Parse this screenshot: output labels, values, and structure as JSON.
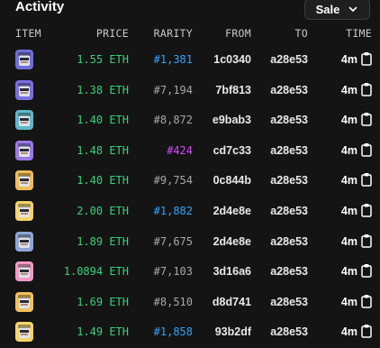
{
  "header": {
    "title": "Activity",
    "filter": "Sale"
  },
  "columns": {
    "item": "ITEM",
    "price": "PRICE",
    "rarity": "RARITY",
    "from": "FROM",
    "to": "TO",
    "time": "TIME"
  },
  "colors": {
    "price": "#34d47a",
    "rarity_blue": "#2fa4ff",
    "rarity_gray": "#a8a8a8",
    "rarity_purple": "#d24bff",
    "background": "#141414"
  },
  "rows": [
    {
      "avatar": "#6f6fd8",
      "price": "1.55 ETH",
      "rarity": "#1,381",
      "rarity_tone": "blue",
      "from": "1c0340",
      "to": "a28e53",
      "time": "4m",
      "icon": "clipboard-icon"
    },
    {
      "avatar": "#7b6fe0",
      "price": "1.38 ETH",
      "rarity": "#7,194",
      "rarity_tone": "gray",
      "from": "7bf813",
      "to": "a28e53",
      "time": "4m",
      "icon": "clipboard-icon"
    },
    {
      "avatar": "#5fb7c9",
      "price": "1.40 ETH",
      "rarity": "#8,872",
      "rarity_tone": "gray",
      "from": "e9bab3",
      "to": "a28e53",
      "time": "4m",
      "icon": "clipboard-icon"
    },
    {
      "avatar": "#9a79e6",
      "price": "1.48 ETH",
      "rarity": "#424",
      "rarity_tone": "purple",
      "from": "cd7c33",
      "to": "a28e53",
      "time": "4m",
      "icon": "clipboard-icon"
    },
    {
      "avatar": "#f0bd5a",
      "price": "1.40 ETH",
      "rarity": "#9,754",
      "rarity_tone": "gray",
      "from": "0c844b",
      "to": "a28e53",
      "time": "4m",
      "icon": "clipboard-icon"
    },
    {
      "avatar": "#f4d36a",
      "price": "2.00 ETH",
      "rarity": "#1,882",
      "rarity_tone": "blue",
      "from": "2d4e8e",
      "to": "a28e53",
      "time": "4m",
      "icon": "clipboard-icon"
    },
    {
      "avatar": "#8fa7d6",
      "price": "1.89 ETH",
      "rarity": "#7,675",
      "rarity_tone": "gray",
      "from": "2d4e8e",
      "to": "a28e53",
      "time": "4m",
      "icon": "clipboard-icon"
    },
    {
      "avatar": "#f39ac4",
      "price": "1.0894 ETH",
      "rarity": "#7,103",
      "rarity_tone": "gray",
      "from": "3d16a6",
      "to": "a28e53",
      "time": "4m",
      "icon": "clipboard-icon"
    },
    {
      "avatar": "#f2c15e",
      "price": "1.69 ETH",
      "rarity": "#8,510",
      "rarity_tone": "gray",
      "from": "d8d741",
      "to": "a28e53",
      "time": "4m",
      "icon": "clipboard-icon"
    },
    {
      "avatar": "#f5d46b",
      "price": "1.49 ETH",
      "rarity": "#1,858",
      "rarity_tone": "blue",
      "from": "93b2df",
      "to": "a28e53",
      "time": "4m",
      "icon": "clipboard-icon"
    }
  ]
}
